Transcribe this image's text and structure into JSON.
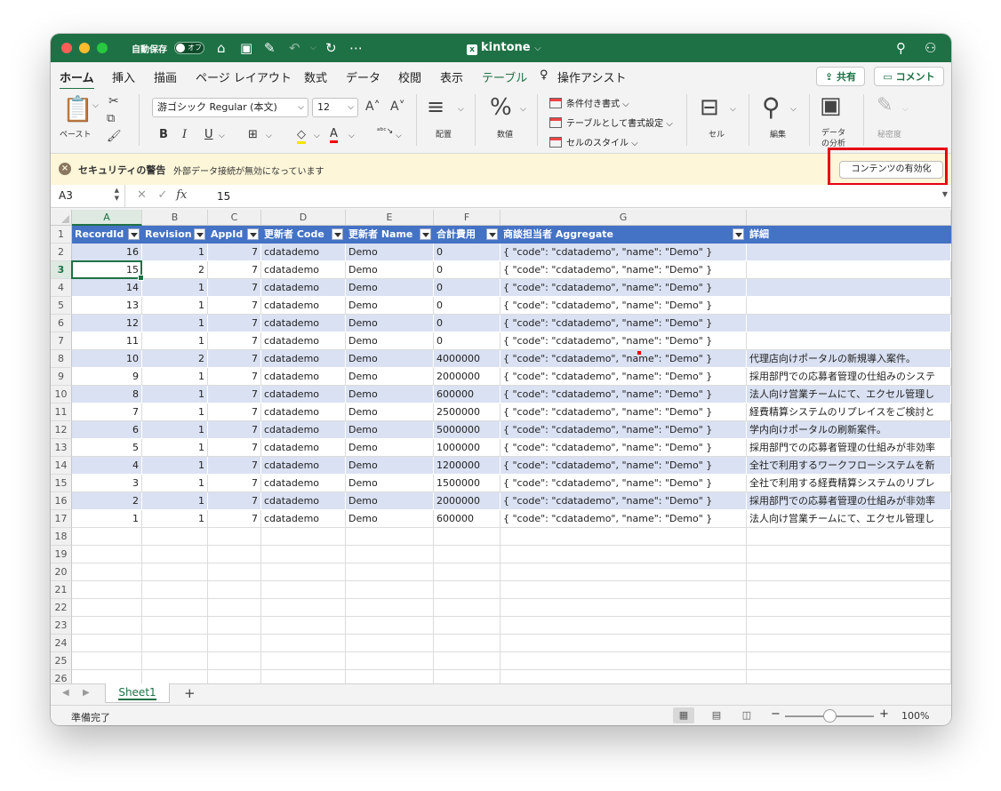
{
  "titlebar": {
    "autosave_label": "自動保存",
    "autosave_state": "オフ",
    "doc_title": "kintone",
    "doc_title_chevron": "⌵"
  },
  "menu_tabs": [
    "ホーム",
    "挿入",
    "描画",
    "ページ レイアウト",
    "数式",
    "データ",
    "校閲",
    "表示",
    "テーブル",
    "操作アシスト"
  ],
  "share_label": "共有",
  "comment_label": "コメント",
  "ribbon": {
    "paste_label": "ペースト",
    "font_name": "游ゴシック Regular (本文)",
    "font_size": "12",
    "bold": "B",
    "italic": "I",
    "underline": "U",
    "alignment_label": "配置",
    "number_label": "数値",
    "conditional_format": "条件付き書式",
    "format_as_table": "テーブルとして書式設定",
    "cell_styles": "セルのスタイル",
    "cells_label": "セル",
    "editing_label": "編集",
    "analyze_label_1": "データ",
    "analyze_label_2": "の分析",
    "sensitivity_label": "秘密度"
  },
  "security_bar": {
    "title": "セキュリティの警告",
    "message": "外部データ接続が無効になっています",
    "enable_button": "コンテンツの有効化"
  },
  "formula_bar": {
    "name_box": "A3",
    "fx": "fx",
    "value": "15"
  },
  "columns": [
    "A",
    "B",
    "C",
    "D",
    "E",
    "F",
    "G",
    ""
  ],
  "selected_column": "A",
  "selected_row": 3,
  "header_row": [
    "RecordId",
    "Revision",
    "AppId",
    "更新者 Code",
    "更新者 Name",
    "合計費用",
    "商談担当者 Aggregate",
    "詳細"
  ],
  "rows": [
    [
      "16",
      "1",
      "7",
      "cdatademo",
      "Demo",
      "0",
      "{   \"code\": \"cdatademo\",    \"name\": \"Demo\"  }",
      ""
    ],
    [
      "15",
      "2",
      "7",
      "cdatademo",
      "Demo",
      "0",
      "{   \"code\": \"cdatademo\",    \"name\": \"Demo\"  }",
      ""
    ],
    [
      "14",
      "1",
      "7",
      "cdatademo",
      "Demo",
      "0",
      "{   \"code\": \"cdatademo\",    \"name\": \"Demo\"  }",
      ""
    ],
    [
      "13",
      "1",
      "7",
      "cdatademo",
      "Demo",
      "0",
      "{   \"code\": \"cdatademo\",    \"name\": \"Demo\"  }",
      ""
    ],
    [
      "12",
      "1",
      "7",
      "cdatademo",
      "Demo",
      "0",
      "{   \"code\": \"cdatademo\",    \"name\": \"Demo\"  }",
      ""
    ],
    [
      "11",
      "1",
      "7",
      "cdatademo",
      "Demo",
      "0",
      "{   \"code\": \"cdatademo\",    \"name\": \"Demo\"  }",
      ""
    ],
    [
      "10",
      "2",
      "7",
      "cdatademo",
      "Demo",
      "4000000",
      "{   \"code\": \"cdatademo\",    \"name\": \"Demo\"  }",
      "代理店向けポータルの新規導入案件。"
    ],
    [
      "9",
      "1",
      "7",
      "cdatademo",
      "Demo",
      "2000000",
      "{   \"code\": \"cdatademo\",    \"name\": \"Demo\"  }",
      "採用部門での応募者管理の仕組みのシステ"
    ],
    [
      "8",
      "1",
      "7",
      "cdatademo",
      "Demo",
      "600000",
      "{   \"code\": \"cdatademo\",    \"name\": \"Demo\"  }",
      "法人向け営業チームにて、エクセル管理し"
    ],
    [
      "7",
      "1",
      "7",
      "cdatademo",
      "Demo",
      "2500000",
      "{   \"code\": \"cdatademo\",    \"name\": \"Demo\"  }",
      "経費精算システムのリプレイスをご検討と"
    ],
    [
      "6",
      "1",
      "7",
      "cdatademo",
      "Demo",
      "5000000",
      "{   \"code\": \"cdatademo\",    \"name\": \"Demo\"  }",
      "学内向けポータルの刷新案件。"
    ],
    [
      "5",
      "1",
      "7",
      "cdatademo",
      "Demo",
      "1000000",
      "{   \"code\": \"cdatademo\",    \"name\": \"Demo\"  }",
      "採用部門での応募者管理の仕組みが非効率"
    ],
    [
      "4",
      "1",
      "7",
      "cdatademo",
      "Demo",
      "1200000",
      "{   \"code\": \"cdatademo\",    \"name\": \"Demo\"  }",
      "全社で利用するワークフローシステムを新"
    ],
    [
      "3",
      "1",
      "7",
      "cdatademo",
      "Demo",
      "1500000",
      "{   \"code\": \"cdatademo\",    \"name\": \"Demo\"  }",
      "全社で利用する経費精算システムのリプレ"
    ],
    [
      "2",
      "1",
      "7",
      "cdatademo",
      "Demo",
      "2000000",
      "{   \"code\": \"cdatademo\",    \"name\": \"Demo\"  }",
      "採用部門での応募者管理の仕組みが非効率"
    ],
    [
      "1",
      "1",
      "7",
      "cdatademo",
      "Demo",
      "600000",
      "{   \"code\": \"cdatademo\",    \"name\": \"Demo\"  }",
      "法人向け営業チームにて、エクセル管理し"
    ]
  ],
  "row_numbers": [
    "1",
    "2",
    "3",
    "4",
    "5",
    "6",
    "7",
    "8",
    "9",
    "10",
    "11",
    "12",
    "13",
    "14",
    "15",
    "16",
    "17",
    "18",
    "19",
    "20",
    "21",
    "22",
    "23",
    "24",
    "25",
    "26"
  ],
  "sheet_tabs": [
    "Sheet1"
  ],
  "add_sheet": "+",
  "status": {
    "text": "準備完了",
    "zoom": "100%",
    "zoom_fraction": 0.5
  },
  "colors": {
    "excel_green": "#1e7145",
    "table_header": "#4472c4",
    "table_band": "#d9e1f2",
    "highlight_red": "#e60012"
  }
}
